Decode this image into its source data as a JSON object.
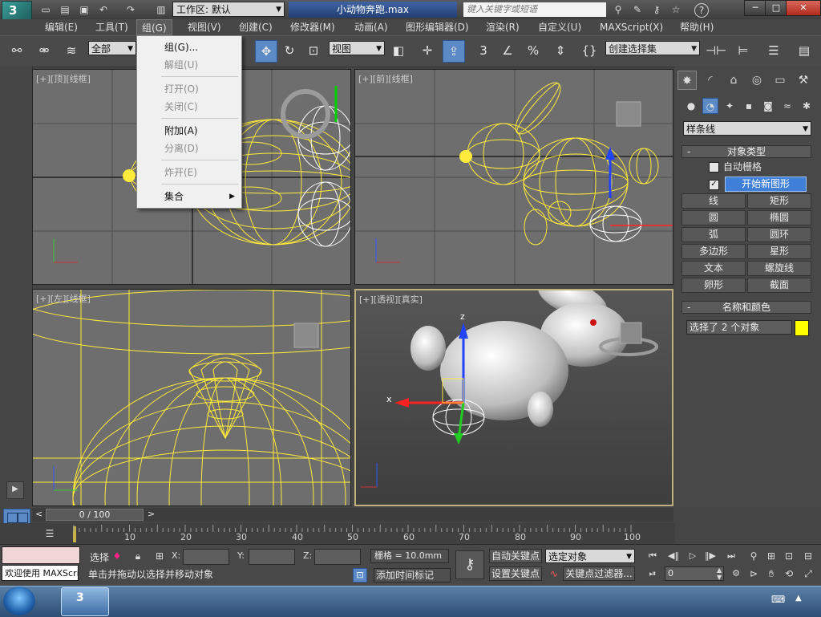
{
  "title_bar": {
    "workspace": "工作区: 默认",
    "file_title": "小动物奔跑.max",
    "search_placeholder": "键入关键字或短语",
    "win_min": "─",
    "win_max": "□",
    "win_close": "✕",
    "help": "?"
  },
  "menu": {
    "items": [
      "编辑(E)",
      "工具(T)",
      "组(G)",
      "视图(V)",
      "创建(C)",
      "修改器(M)",
      "动画(A)",
      "图形编辑器(D)",
      "渲染(R)",
      "自定义(U)",
      "MAXScript(X)",
      "帮助(H)"
    ]
  },
  "group_menu": {
    "items": [
      {
        "label": "组(G)...",
        "enabled": true
      },
      {
        "label": "解组(U)",
        "enabled": false
      },
      {
        "label": "打开(O)",
        "enabled": false
      },
      {
        "label": "关闭(C)",
        "enabled": false
      },
      {
        "label": "附加(A)",
        "enabled": true
      },
      {
        "label": "分离(D)",
        "enabled": false
      },
      {
        "label": "炸开(E)",
        "enabled": false
      },
      {
        "label": "集合",
        "enabled": true
      }
    ]
  },
  "toolbar": {
    "filter": "全部",
    "ref_coord": "视图",
    "snap_label": "3",
    "selection_set": "创建选择集"
  },
  "viewports": {
    "top": "[+][顶][线框]",
    "front": "[+][前][线框]",
    "left": "[+][左][线框]",
    "persp": "[+][透视][真实]",
    "x_axis": "x",
    "z_axis": "z"
  },
  "command_panel": {
    "category": "样条线",
    "object_type_title": "对象类型",
    "autogrid": "自动栅格",
    "start_new_shape": "开始新图形",
    "start_new_checked": "✓",
    "buttons": [
      "线",
      "矩形",
      "圆",
      "椭圆",
      "弧",
      "圆环",
      "多边形",
      "星形",
      "文本",
      "螺旋线",
      "卵形",
      "截面"
    ],
    "name_color_title": "名称和颜色",
    "name_value": "选择了 2 个对象",
    "color": "#ffff00",
    "minus": "-"
  },
  "timeline": {
    "slider": "0 / 100",
    "left_arrow": "<",
    "right_arrow": ">",
    "ticks": [
      "10",
      "20",
      "30",
      "40",
      "50",
      "60",
      "70",
      "80",
      "90",
      "100"
    ]
  },
  "status": {
    "listener": "欢迎使用 MAXScri",
    "select_label": "选择",
    "prompt": "单击并拖动以选择并移动对象",
    "x_label": "X:",
    "y_label": "Y:",
    "z_label": "Z:",
    "grid": "栅格 = 10.0mm",
    "add_time_tag": "添加时间标记",
    "auto_key": "自动关键点",
    "set_key": "设置关键点",
    "key_mode": "选定对象",
    "key_filters": "关键点过滤器...",
    "frame": "0"
  }
}
